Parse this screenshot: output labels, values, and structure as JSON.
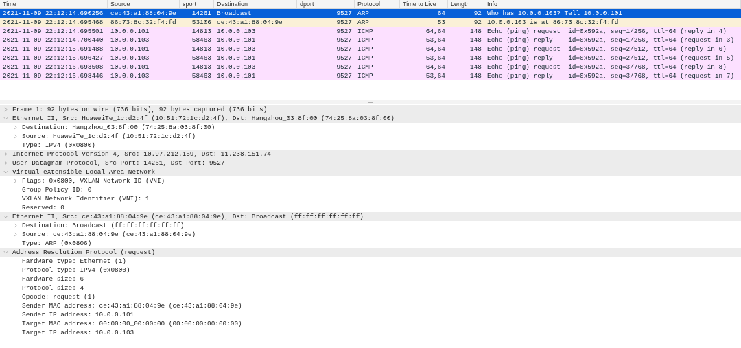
{
  "packet_list": {
    "columns": [
      {
        "label": "Time"
      },
      {
        "label": "Source"
      },
      {
        "label": "sport"
      },
      {
        "label": "Destination"
      },
      {
        "label": "dport"
      },
      {
        "label": "Protocol"
      },
      {
        "label": "Time to Live"
      },
      {
        "label": "Length"
      },
      {
        "label": "Info"
      }
    ],
    "rows": [
      {
        "selected": true,
        "cells": [
          "2021-11-09 22:12:14.690256",
          "ce:43:a1:88:04:9e",
          "14261",
          "Broadcast",
          "9527",
          "ARP",
          "64",
          "92",
          "Who has 10.0.0.103? Tell 10.0.0.101"
        ]
      },
      {
        "kind": "arp",
        "selected": false,
        "cells": [
          "2021-11-09 22:12:14.695468",
          "86:73:8c:32:f4:fd",
          "53106",
          "ce:43:a1:88:04:9e",
          "9527",
          "ARP",
          "53",
          "92",
          "10.0.0.103 is at 86:73:8c:32:f4:fd"
        ]
      },
      {
        "kind": "icmp",
        "selected": false,
        "cells": [
          "2021-11-09 22:12:14.695501",
          "10.0.0.101",
          "14813",
          "10.0.0.103",
          "9527",
          "ICMP",
          "64,64",
          "148",
          "Echo (ping) request  id=0x592a, seq=1/256, ttl=64 (reply in 4)"
        ]
      },
      {
        "kind": "icmp",
        "selected": false,
        "cells": [
          "2021-11-09 22:12:14.700440",
          "10.0.0.103",
          "58463",
          "10.0.0.101",
          "9527",
          "ICMP",
          "53,64",
          "148",
          "Echo (ping) reply    id=0x592a, seq=1/256, ttl=64 (request in 3)"
        ]
      },
      {
        "kind": "icmp",
        "selected": false,
        "cells": [
          "2021-11-09 22:12:15.691488",
          "10.0.0.101",
          "14813",
          "10.0.0.103",
          "9527",
          "ICMP",
          "64,64",
          "148",
          "Echo (ping) request  id=0x592a, seq=2/512, ttl=64 (reply in 6)"
        ]
      },
      {
        "kind": "icmp",
        "selected": false,
        "cells": [
          "2021-11-09 22:12:15.696427",
          "10.0.0.103",
          "58463",
          "10.0.0.101",
          "9527",
          "ICMP",
          "53,64",
          "148",
          "Echo (ping) reply    id=0x592a, seq=2/512, ttl=64 (request in 5)"
        ]
      },
      {
        "kind": "icmp",
        "selected": false,
        "cells": [
          "2021-11-09 22:12:16.693508",
          "10.0.0.101",
          "14813",
          "10.0.0.103",
          "9527",
          "ICMP",
          "64,64",
          "148",
          "Echo (ping) request  id=0x592a, seq=3/768, ttl=64 (reply in 8)"
        ]
      },
      {
        "kind": "icmp",
        "selected": false,
        "cells": [
          "2021-11-09 22:12:16.698446",
          "10.0.0.103",
          "58463",
          "10.0.0.101",
          "9527",
          "ICMP",
          "53,64",
          "148",
          "Echo (ping) reply    id=0x592a, seq=3/768, ttl=64 (request in 7)"
        ]
      }
    ]
  },
  "packet_details": [
    {
      "text": "Frame 1: 92 bytes on wire (736 bits), 92 bytes captured (736 bits)",
      "expanded": false
    },
    {
      "text": "Ethernet II, Src: HuaweiTe_1c:d2:4f (10:51:72:1c:d2:4f), Dst: Hangzhou_03:8f:00 (74:25:8a:03:8f:00)",
      "expanded": true,
      "children": [
        {
          "text": "Destination: Hangzhou_03:8f:00 (74:25:8a:03:8f:00)",
          "expanded": false
        },
        {
          "text": "Source: HuaweiTe_1c:d2:4f (10:51:72:1c:d2:4f)",
          "expanded": false
        },
        {
          "text": "Type: IPv4 (0x0800)"
        }
      ]
    },
    {
      "text": "Internet Protocol Version 4, Src: 10.97.212.159, Dst: 11.238.151.74",
      "expanded": false
    },
    {
      "text": "User Datagram Protocol, Src Port: 14261, Dst Port: 9527",
      "expanded": false
    },
    {
      "text": "Virtual eXtensible Local Area Network",
      "expanded": true,
      "children": [
        {
          "text": "Flags: 0x0800, VXLAN Network ID (VNI)",
          "expanded": false
        },
        {
          "text": "Group Policy ID: 0"
        },
        {
          "text": "VXLAN Network Identifier (VNI): 1"
        },
        {
          "text": "Reserved: 0"
        }
      ]
    },
    {
      "text": "Ethernet II, Src: ce:43:a1:88:04:9e (ce:43:a1:88:04:9e), Dst: Broadcast (ff:ff:ff:ff:ff:ff)",
      "expanded": true,
      "children": [
        {
          "text": "Destination: Broadcast (ff:ff:ff:ff:ff:ff)",
          "expanded": false
        },
        {
          "text": "Source: ce:43:a1:88:04:9e (ce:43:a1:88:04:9e)",
          "expanded": false
        },
        {
          "text": "Type: ARP (0x0806)"
        }
      ]
    },
    {
      "text": "Address Resolution Protocol (request)",
      "expanded": true,
      "children": [
        {
          "text": "Hardware type: Ethernet (1)"
        },
        {
          "text": "Protocol type: IPv4 (0x0800)"
        },
        {
          "text": "Hardware size: 6"
        },
        {
          "text": "Protocol size: 4"
        },
        {
          "text": "Opcode: request (1)"
        },
        {
          "text": "Sender MAC address: ce:43:a1:88:04:9e (ce:43:a1:88:04:9e)"
        },
        {
          "text": "Sender IP address: 10.0.0.101"
        },
        {
          "text": "Target MAC address: 00:00:00_00:00:00 (00:00:00:00:00:00)"
        },
        {
          "text": "Target IP address: 10.0.0.103"
        }
      ]
    }
  ]
}
